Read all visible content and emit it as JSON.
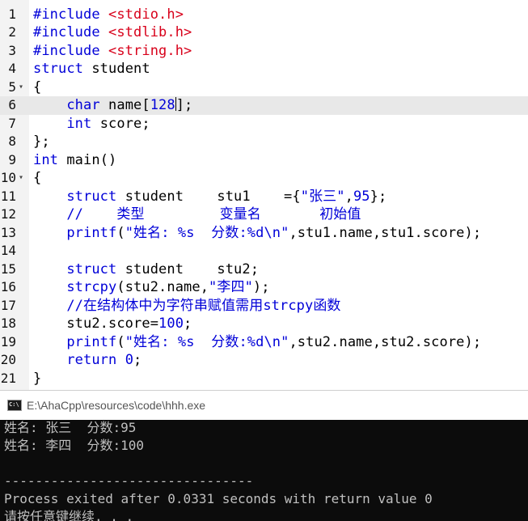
{
  "editor": {
    "lines": [
      {
        "n": "1",
        "fold": "",
        "tokens": [
          {
            "c": "pp",
            "t": "#include "
          },
          {
            "c": "inc",
            "t": "<stdio.h>"
          }
        ]
      },
      {
        "n": "2",
        "fold": "",
        "tokens": [
          {
            "c": "pp",
            "t": "#include "
          },
          {
            "c": "inc",
            "t": "<stdlib.h>"
          }
        ]
      },
      {
        "n": "3",
        "fold": "",
        "tokens": [
          {
            "c": "pp",
            "t": "#include "
          },
          {
            "c": "inc",
            "t": "<string.h>"
          }
        ]
      },
      {
        "n": "4",
        "fold": "",
        "tokens": [
          {
            "c": "kw",
            "t": "struct"
          },
          {
            "c": "",
            "t": " student"
          }
        ]
      },
      {
        "n": "5",
        "fold": "▾",
        "tokens": [
          {
            "c": "",
            "t": "{"
          }
        ]
      },
      {
        "n": "6",
        "fold": "",
        "current": true,
        "tokens": [
          {
            "c": "",
            "t": "    "
          },
          {
            "c": "kw",
            "t": "char"
          },
          {
            "c": "",
            "t": " name["
          },
          {
            "c": "num",
            "t": "128"
          },
          {
            "c": "cursor",
            "t": ""
          },
          {
            "c": "",
            "t": "];"
          }
        ]
      },
      {
        "n": "7",
        "fold": "",
        "tokens": [
          {
            "c": "",
            "t": "    "
          },
          {
            "c": "kw",
            "t": "int"
          },
          {
            "c": "",
            "t": " score;"
          }
        ]
      },
      {
        "n": "8",
        "fold": "",
        "tokens": [
          {
            "c": "",
            "t": "};"
          }
        ]
      },
      {
        "n": "9",
        "fold": "",
        "tokens": [
          {
            "c": "kw",
            "t": "int"
          },
          {
            "c": "",
            "t": " main()"
          }
        ]
      },
      {
        "n": "10",
        "fold": "▾",
        "tokens": [
          {
            "c": "",
            "t": "{"
          }
        ]
      },
      {
        "n": "11",
        "fold": "",
        "tokens": [
          {
            "c": "",
            "t": "    "
          },
          {
            "c": "kw",
            "t": "struct"
          },
          {
            "c": "",
            "t": " student    stu1    ={"
          },
          {
            "c": "str",
            "t": "\"张三\""
          },
          {
            "c": "",
            "t": ","
          },
          {
            "c": "num",
            "t": "95"
          },
          {
            "c": "",
            "t": "};"
          }
        ]
      },
      {
        "n": "12",
        "fold": "",
        "tokens": [
          {
            "c": "",
            "t": "    "
          },
          {
            "c": "cm",
            "t": "//    类型         变量名       初始值"
          }
        ]
      },
      {
        "n": "13",
        "fold": "",
        "tokens": [
          {
            "c": "",
            "t": "    "
          },
          {
            "c": "kw",
            "t": "printf"
          },
          {
            "c": "",
            "t": "("
          },
          {
            "c": "str",
            "t": "\"姓名: %s  分数:%d\\n\""
          },
          {
            "c": "",
            "t": ",stu1.name,stu1.score);"
          }
        ]
      },
      {
        "n": "14",
        "fold": "",
        "tokens": []
      },
      {
        "n": "15",
        "fold": "",
        "tokens": [
          {
            "c": "",
            "t": "    "
          },
          {
            "c": "kw",
            "t": "struct"
          },
          {
            "c": "",
            "t": " student    stu2;"
          }
        ]
      },
      {
        "n": "16",
        "fold": "",
        "tokens": [
          {
            "c": "",
            "t": "    "
          },
          {
            "c": "kw",
            "t": "strcpy"
          },
          {
            "c": "",
            "t": "(stu2.name,"
          },
          {
            "c": "str",
            "t": "\"李四\""
          },
          {
            "c": "",
            "t": ");"
          }
        ]
      },
      {
        "n": "17",
        "fold": "",
        "tokens": [
          {
            "c": "",
            "t": "    "
          },
          {
            "c": "cm",
            "t": "//在结构体中为字符串赋值需用strcpy函数"
          }
        ]
      },
      {
        "n": "18",
        "fold": "",
        "tokens": [
          {
            "c": "",
            "t": "    stu2.score="
          },
          {
            "c": "num",
            "t": "100"
          },
          {
            "c": "",
            "t": ";"
          }
        ]
      },
      {
        "n": "19",
        "fold": "",
        "tokens": [
          {
            "c": "",
            "t": "    "
          },
          {
            "c": "kw",
            "t": "printf"
          },
          {
            "c": "",
            "t": "("
          },
          {
            "c": "str",
            "t": "\"姓名: %s  分数:%d\\n\""
          },
          {
            "c": "",
            "t": ",stu2.name,stu2.score);"
          }
        ]
      },
      {
        "n": "20",
        "fold": "",
        "tokens": [
          {
            "c": "",
            "t": "    "
          },
          {
            "c": "kw",
            "t": "return"
          },
          {
            "c": "",
            "t": " "
          },
          {
            "c": "num",
            "t": "0"
          },
          {
            "c": "",
            "t": ";"
          }
        ]
      },
      {
        "n": "21",
        "fold": "",
        "tokens": [
          {
            "c": "",
            "t": "}"
          }
        ]
      }
    ]
  },
  "console": {
    "icon": "cmd-window-icon",
    "icon_label": "C:\\",
    "title": "E:\\AhaCpp\\resources\\code\\hhh.exe",
    "lines": [
      "姓名: 张三  分数:95",
      "姓名: 李四  分数:100",
      "",
      "--------------------------------",
      "Process exited after 0.0331 seconds with return value 0",
      "请按任意键继续. . ."
    ]
  },
  "colors": {
    "keyword": "#0000d8",
    "include_path": "#d8001a",
    "current_line": "#e8e8e8",
    "terminal_bg": "#0c0c0c",
    "terminal_fg": "#c0c0c0"
  }
}
